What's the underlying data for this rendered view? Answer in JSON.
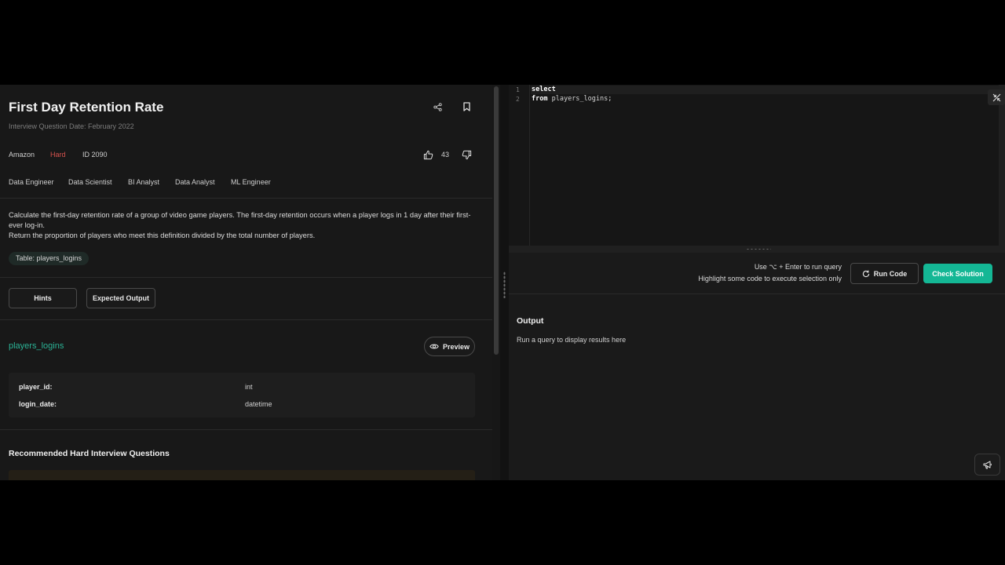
{
  "question": {
    "title": "First Day Retention Rate",
    "date": "Interview Question Date: February 2022",
    "company": "Amazon",
    "difficulty": "Hard",
    "id": "ID 2090",
    "votes": "43",
    "roles": [
      "Data Engineer",
      "Data Scientist",
      "BI Analyst",
      "Data Analyst",
      "ML Engineer"
    ],
    "description_line1": "Calculate the first-day retention rate of a group of video game players. The first-day retention occurs when a player logs in 1 day after their first-ever log-in.",
    "description_line2": "Return the proportion of players who meet this definition divided by the total number of players.",
    "table_chip": "Table: players_logins"
  },
  "buttons": {
    "hints": "Hints",
    "expected_output": "Expected Output",
    "preview": "Preview",
    "run_code": "Run Code",
    "check_solution": "Check Solution"
  },
  "schema": {
    "table_name": "players_logins",
    "columns": [
      {
        "name": "player_id:",
        "type": "int"
      },
      {
        "name": "login_date:",
        "type": "datetime"
      }
    ]
  },
  "recommended_title": "Recommended Hard Interview Questions",
  "editor": {
    "lines": [
      {
        "num": "1",
        "keyword": "select",
        "rest": ""
      },
      {
        "num": "2",
        "keyword": "from",
        "rest": " players_logins;"
      }
    ]
  },
  "run_hints": {
    "line1": "Use ⌥ + Enter to run query",
    "line2": "Highlight some code to execute selection only"
  },
  "output": {
    "title": "Output",
    "placeholder": "Run a query to display results here"
  },
  "colors": {
    "accent": "#14b795",
    "difficulty_hard": "#d9534f",
    "table_link": "#2bb396"
  },
  "icons": [
    "share-icon",
    "bookmark-icon",
    "thumbs-up-icon",
    "thumbs-down-icon",
    "eye-icon",
    "refresh-icon",
    "collapse-icon",
    "megaphone-icon"
  ]
}
